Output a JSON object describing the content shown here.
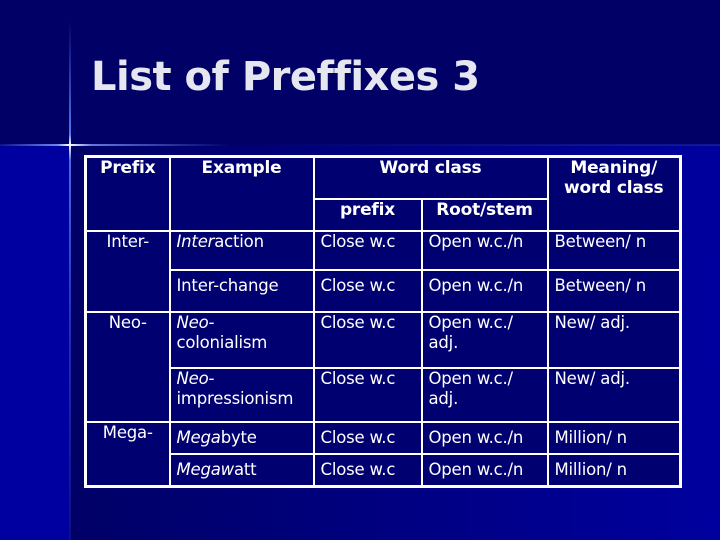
{
  "slide": {
    "title": "List of Preffixes 3"
  },
  "table": {
    "headers": {
      "prefix": "Prefix",
      "example": "Example",
      "word_class": "Word class",
      "word_class_prefix": "prefix",
      "word_class_root": "Root/stem",
      "meaning": "Meaning/ word class"
    },
    "groups": [
      {
        "prefix": "Inter-",
        "rows": [
          {
            "example_italic": "Inter",
            "example_rest": "action",
            "wc_prefix": "Close w.c",
            "wc_root": "Open w.c./n",
            "meaning": "Between/ n"
          },
          {
            "example_italic": "",
            "example_rest": "Inter-change",
            "wc_prefix": "Close w.c",
            "wc_root": "Open w.c./n",
            "meaning": "Between/ n"
          }
        ]
      },
      {
        "prefix": "Neo-",
        "rows": [
          {
            "example_italic": "Neo-",
            "example_rest": "colonialism",
            "wc_prefix": "Close w.c",
            "wc_root": "Open w.c./ adj.",
            "meaning": "New/ adj."
          },
          {
            "example_italic": "Neo-",
            "example_rest": "impressionism",
            "wc_prefix": "Close w.c",
            "wc_root": "Open w.c./ adj.",
            "meaning": "New/ adj."
          }
        ]
      },
      {
        "prefix": "Mega-",
        "rows": [
          {
            "example_italic": "Mega",
            "example_rest": "byte",
            "wc_prefix": "Close w.c",
            "wc_root": "Open w.c./n",
            "meaning": "Million/ n"
          },
          {
            "example_italic": "Megaw",
            "example_rest": "att",
            "wc_prefix": "Close w.c",
            "wc_root": "Open w.c./n",
            "meaning": "Million/ n"
          }
        ]
      }
    ]
  },
  "colors": {
    "background_dark": "#000066",
    "background_bright": "#0000a0",
    "cell_fill": "#000070",
    "border": "#ffffff",
    "text": "#ffffff",
    "title_text": "#e6e6f0"
  }
}
